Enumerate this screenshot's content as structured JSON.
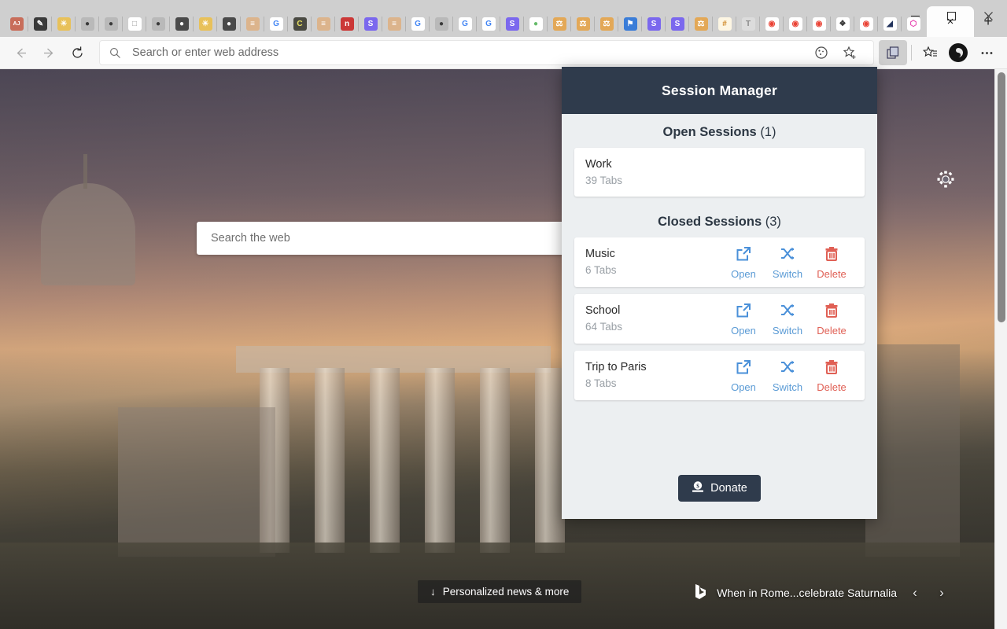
{
  "window": {
    "controls": {
      "minimize": "minimize-button",
      "maximize": "maximize-button",
      "close": "close-button"
    },
    "new_tab_label": "+",
    "active_tab_close": "×"
  },
  "tabs": [
    {
      "icon": "AJ",
      "kind": "text",
      "bg": "#c86d5a",
      "fg": "#ffffff"
    },
    {
      "icon": "paint-icon",
      "kind": "glyph",
      "glyph": "✎",
      "bg": "#3a3a3a",
      "fg": "#ffffff"
    },
    {
      "icon": "lock-sun-icon",
      "kind": "glyph",
      "glyph": "☀",
      "bg": "#e8c15a",
      "fg": "#ffffff"
    },
    {
      "icon": "github-icon",
      "kind": "glyph",
      "glyph": "●",
      "bg": "#b9b9b9",
      "fg": "#3a3a3a"
    },
    {
      "icon": "github-icon",
      "kind": "glyph",
      "glyph": "●",
      "bg": "#b9b9b9",
      "fg": "#3a3a3a"
    },
    {
      "icon": "page-icon",
      "kind": "glyph",
      "glyph": "□",
      "bg": "#ffffff",
      "fg": "#9a9a9a"
    },
    {
      "icon": "github-icon",
      "kind": "glyph",
      "glyph": "●",
      "bg": "#b9b9b9",
      "fg": "#3a3a3a"
    },
    {
      "icon": "ghost-icon",
      "kind": "glyph",
      "glyph": "●",
      "bg": "#4a4a4a",
      "fg": "#ffffff"
    },
    {
      "icon": "lock-sun-icon",
      "kind": "glyph",
      "glyph": "☀",
      "bg": "#e8c15a",
      "fg": "#ffffff"
    },
    {
      "icon": "ghost-icon",
      "kind": "glyph",
      "glyph": "●",
      "bg": "#4a4a4a",
      "fg": "#ffffff"
    },
    {
      "icon": "stackoverflow-icon",
      "kind": "glyph",
      "glyph": "≡",
      "bg": "#dcb48c",
      "fg": "#ffffff"
    },
    {
      "icon": "google-icon",
      "kind": "text",
      "text": "G",
      "bg": "#ffffff",
      "fg": "#4285f4"
    },
    {
      "icon": "c-icon",
      "kind": "text",
      "text": "C",
      "bg": "#4a4a42",
      "fg": "#e8e060"
    },
    {
      "icon": "stackoverflow-icon",
      "kind": "glyph",
      "glyph": "≡",
      "bg": "#dcb48c",
      "fg": "#ffffff"
    },
    {
      "icon": "npm-icon",
      "kind": "text",
      "text": "n",
      "bg": "#cb3837",
      "fg": "#ffffff"
    },
    {
      "icon": "slack-icon",
      "kind": "text",
      "text": "S",
      "bg": "#7b68ee",
      "fg": "#ffffff"
    },
    {
      "icon": "stackoverflow-icon",
      "kind": "glyph",
      "glyph": "≡",
      "bg": "#dcb48c",
      "fg": "#ffffff"
    },
    {
      "icon": "google-icon",
      "kind": "text",
      "text": "G",
      "bg": "#ffffff",
      "fg": "#4285f4"
    },
    {
      "icon": "github-icon",
      "kind": "glyph",
      "glyph": "●",
      "bg": "#b9b9b9",
      "fg": "#3a3a3a"
    },
    {
      "icon": "google-icon",
      "kind": "text",
      "text": "G",
      "bg": "#ffffff",
      "fg": "#4285f4"
    },
    {
      "icon": "google-icon",
      "kind": "text",
      "text": "G",
      "bg": "#ffffff",
      "fg": "#4285f4"
    },
    {
      "icon": "slack-icon",
      "kind": "text",
      "text": "S",
      "bg": "#7b68ee",
      "fg": "#ffffff"
    },
    {
      "icon": "green-dot-icon",
      "kind": "glyph",
      "glyph": "●",
      "bg": "#ffffff",
      "fg": "#66bb6a"
    },
    {
      "icon": "scale-icon",
      "kind": "glyph",
      "glyph": "⚖",
      "bg": "#e3a857",
      "fg": "#ffffff"
    },
    {
      "icon": "scale-icon",
      "kind": "glyph",
      "glyph": "⚖",
      "bg": "#e3a857",
      "fg": "#ffffff"
    },
    {
      "icon": "scale-icon",
      "kind": "glyph",
      "glyph": "⚖",
      "bg": "#e3a857",
      "fg": "#ffffff"
    },
    {
      "icon": "flag-icon",
      "kind": "glyph",
      "glyph": "⚑",
      "bg": "#3b7dd8",
      "fg": "#ffffff"
    },
    {
      "icon": "slack-icon",
      "kind": "text",
      "text": "S",
      "bg": "#7b68ee",
      "fg": "#ffffff"
    },
    {
      "icon": "slack-icon",
      "kind": "text",
      "text": "S",
      "bg": "#7b68ee",
      "fg": "#ffffff"
    },
    {
      "icon": "scale-icon",
      "kind": "glyph",
      "glyph": "⚖",
      "bg": "#e3a857",
      "fg": "#ffffff"
    },
    {
      "icon": "hash-icon",
      "kind": "text",
      "text": "#",
      "bg": "#fdf6e3",
      "fg": "#d08b2c"
    },
    {
      "icon": "t-icon",
      "kind": "text",
      "text": "T",
      "bg": "#dcdcdc",
      "fg": "#888888"
    },
    {
      "icon": "chrome-icon",
      "kind": "glyph",
      "glyph": "◉",
      "bg": "#ffffff",
      "fg": "#ea4335"
    },
    {
      "icon": "chrome-icon",
      "kind": "glyph",
      "glyph": "◉",
      "bg": "#ffffff",
      "fg": "#ea4335"
    },
    {
      "icon": "chrome-icon",
      "kind": "glyph",
      "glyph": "◉",
      "bg": "#ffffff",
      "fg": "#ea4335"
    },
    {
      "icon": "puzzle-icon",
      "kind": "glyph",
      "glyph": "❖",
      "bg": "#ffffff",
      "fg": "#3a3a3a"
    },
    {
      "icon": "chrome-icon",
      "kind": "glyph",
      "glyph": "◉",
      "bg": "#ffffff",
      "fg": "#ea4335"
    },
    {
      "icon": "prisma-icon",
      "kind": "glyph",
      "glyph": "◢",
      "bg": "#ffffff",
      "fg": "#21325b"
    },
    {
      "icon": "graphql-icon",
      "kind": "glyph",
      "glyph": "⬡",
      "bg": "#ffffff",
      "fg": "#e535ab"
    }
  ],
  "toolbar": {
    "back_label": "Back",
    "forward_label": "Forward",
    "refresh_label": "Refresh",
    "address_placeholder": "Search or enter web address",
    "tracking_label": "Tracking prevention",
    "favorite_label": "Add this page to favorites",
    "extension_label": "Session Manager extension",
    "favorites_label": "Favorites",
    "profile_label": "Profile",
    "settings_label": "Settings and more"
  },
  "newtab": {
    "search_placeholder": "Search the web",
    "settings_label": "Page settings",
    "news_label": "Personalized news & more",
    "image_caption": "When in Rome...celebrate Saturnalia",
    "prev_label": "Previous image",
    "next_label": "Next image"
  },
  "panel": {
    "title": "Session Manager",
    "open_section": {
      "label": "Open Sessions",
      "count": "(1)"
    },
    "closed_section": {
      "label": "Closed Sessions",
      "count": "(3)"
    },
    "open_sessions": [
      {
        "name": "Work",
        "tabs": "39 Tabs"
      }
    ],
    "closed_sessions": [
      {
        "name": "Music",
        "tabs": "6 Tabs"
      },
      {
        "name": "School",
        "tabs": "64 Tabs"
      },
      {
        "name": "Trip to Paris",
        "tabs": "8 Tabs"
      }
    ],
    "actions": {
      "open": "Open",
      "switch": "Switch",
      "delete": "Delete"
    },
    "donate_label": "Donate",
    "colors": {
      "header_bg": "#2f3b4c",
      "body_bg": "#eceff1",
      "card_bg": "#ffffff",
      "action_blue": "#5b9bd5",
      "action_red": "#e06055"
    }
  }
}
